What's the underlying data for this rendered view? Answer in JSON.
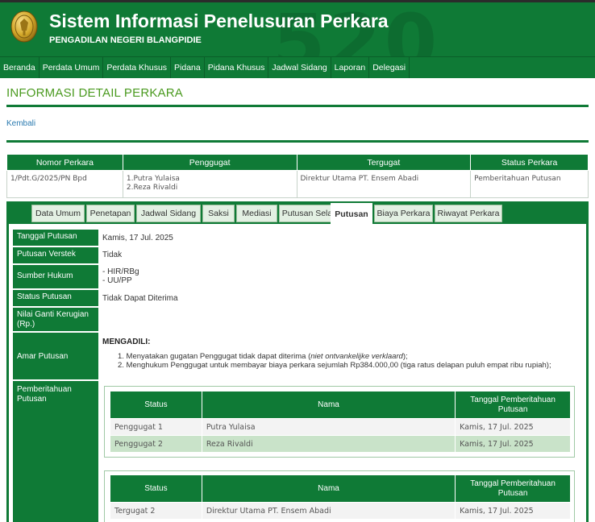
{
  "header": {
    "title": "Sistem Informasi Penelusuran Perkara",
    "subtitle": "PENGADILAN NEGERI BLANGPIDIE",
    "watermark": "520"
  },
  "nav": [
    "Beranda",
    "Perdata Umum",
    "Perdata Khusus",
    "Pidana",
    "Pidana Khusus",
    "Jadwal Sidang",
    "Laporan",
    "Delegasi"
  ],
  "page_title": "INFORMASI DETAIL PERKARA",
  "back_link": "Kembali",
  "case_table": {
    "headers": [
      "Nomor Perkara",
      "Penggugat",
      "Tergugat",
      "Status Perkara"
    ],
    "nomor": "1/Pdt.G/2025/PN Bpd",
    "penggugat": [
      "1.Putra Yulaisa",
      "2.Reza Rivaldi"
    ],
    "tergugat": "Direktur Utama PT. Ensem Abadi",
    "status": "Pemberitahuan Putusan"
  },
  "tabs": [
    "Data Umum",
    "Penetapan",
    "Jadwal Sidang",
    "Saksi",
    "Mediasi",
    "Putusan Sela",
    "Putusan",
    "Biaya Perkara",
    "Riwayat Perkara"
  ],
  "active_tab": "Putusan",
  "putusan": {
    "tanggal_label": "Tanggal Putusan",
    "tanggal_value": "Kamis, 17 Jul. 2025",
    "verstek_label": "Putusan Verstek",
    "verstek_value": "Tidak",
    "sumber_label": "Sumber Hukum",
    "sumber_values": [
      "- HIR/RBg",
      "- UU/PP"
    ],
    "status_label": "Status Putusan",
    "status_value": "Tidak Dapat Diterima",
    "ganti_rugi_label": "Nilai Ganti Kerugian (Rp.)",
    "ganti_rugi_value": "",
    "amar_label": "Amar Putusan",
    "amar_heading": "MENGADILI:",
    "amar_1_prefix": "1. Menyatakan gugatan Penggugat tidak dapat diterima (",
    "amar_1_italic": "niet ontvankelijke verklaard",
    "amar_1_suffix": ");",
    "amar_2": "2. Menghukum Penggugat untuk membayar biaya perkara sejumlah Rp384.000,00 (tiga ratus delapan puluh empat ribu rupiah);",
    "pemberitahuan_label": "Pemberitahuan Putusan"
  },
  "notice_headers": [
    "Status",
    "Nama",
    "Tanggal Pemberitahuan Putusan"
  ],
  "notice_penggugat": [
    {
      "status": "Penggugat 1",
      "nama": "Putra Yulaisa",
      "tanggal": "Kamis, 17 Jul. 2025"
    },
    {
      "status": "Penggugat 2",
      "nama": "Reza Rivaldi",
      "tanggal": "Kamis, 17 Jul. 2025"
    }
  ],
  "notice_tergugat": [
    {
      "status": "Tergugat 2",
      "nama": "Direktur Utama PT. Ensem Abadi",
      "tanggal": "Kamis, 17 Jul. 2025"
    }
  ],
  "colors": {
    "primary": "#0f7a36",
    "title_green": "#4a9a1f",
    "link_blue": "#2a7ab0",
    "row_alt": "#c9e3c9"
  }
}
